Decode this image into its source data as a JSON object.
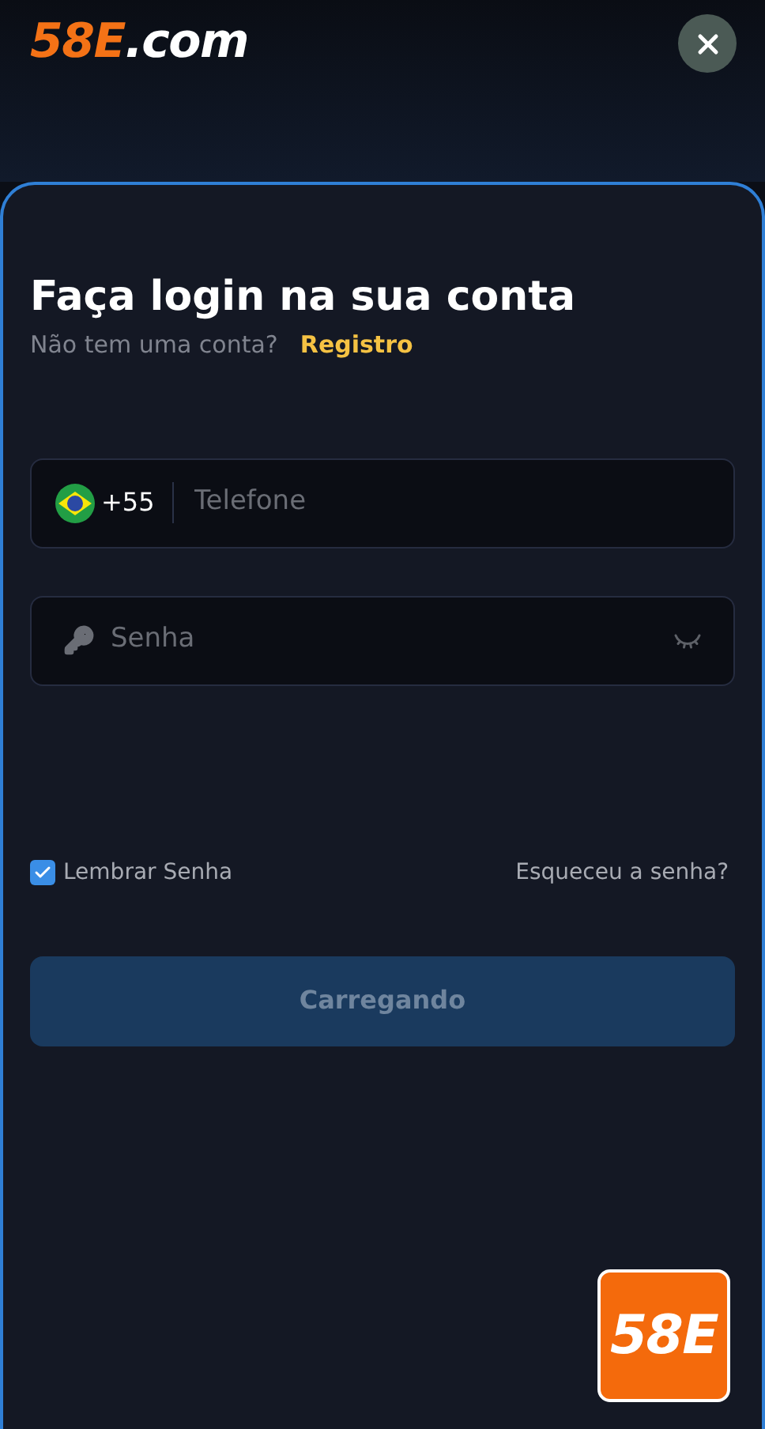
{
  "logo": {
    "brand": "58E",
    "suffix": ".com"
  },
  "title": "Faça login na sua conta",
  "subtitle": {
    "text": "Não tem uma conta?",
    "link": "Registro"
  },
  "phone": {
    "code": "+55",
    "placeholder": "Telefone"
  },
  "password": {
    "placeholder": "Senha"
  },
  "remember": {
    "label": "Lembrar Senha",
    "checked": true
  },
  "forgot": "Esqueceu a senha?",
  "submit": {
    "label": "Carregando",
    "disabled": true
  },
  "badge": "58E"
}
